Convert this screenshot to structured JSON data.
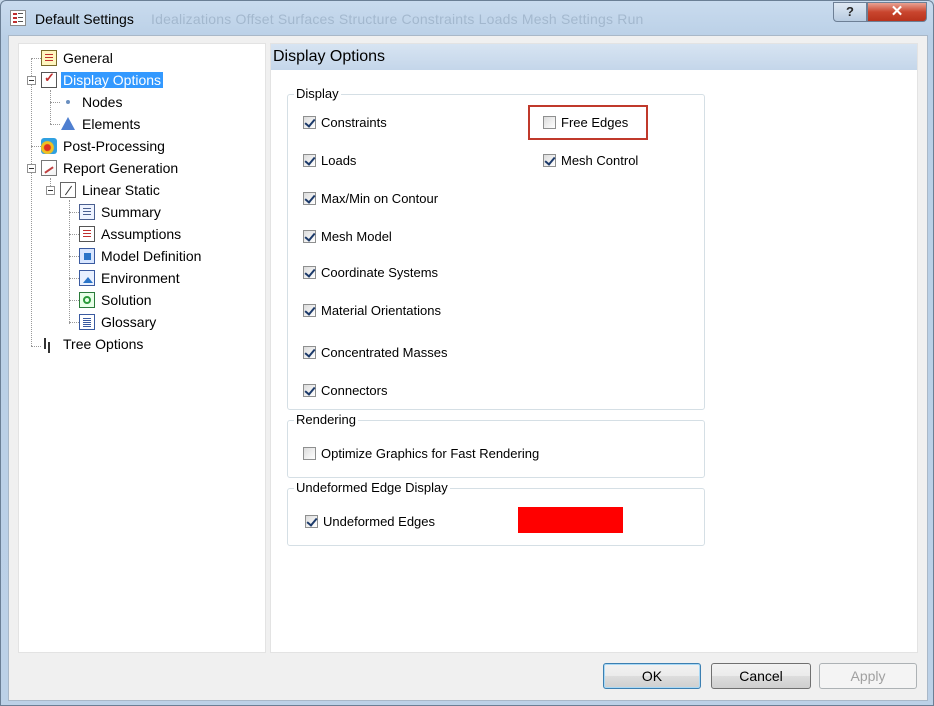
{
  "window": {
    "title": "Default Settings",
    "background_title_ghost": "Idealizations   Offset Surfaces   Structure   Constraints   Loads              Mesh Settings        Run",
    "help_label": "?",
    "close_label": "✕"
  },
  "tree": {
    "items": [
      {
        "label": "General"
      },
      {
        "label": "Display Options"
      },
      {
        "label": "Nodes"
      },
      {
        "label": "Elements"
      },
      {
        "label": "Post-Processing"
      },
      {
        "label": "Report Generation"
      },
      {
        "label": "Linear Static"
      },
      {
        "label": "Summary"
      },
      {
        "label": "Assumptions"
      },
      {
        "label": "Model Definition"
      },
      {
        "label": "Environment"
      },
      {
        "label": "Solution"
      },
      {
        "label": "Glossary"
      },
      {
        "label": "Tree Options"
      }
    ],
    "selected": "Display Options"
  },
  "panel": {
    "title": "Display Options",
    "display_group": {
      "title": "Display",
      "options": [
        {
          "label": "Constraints",
          "checked": true
        },
        {
          "label": "Loads",
          "checked": true
        },
        {
          "label": "Max/Min on Contour",
          "checked": true
        },
        {
          "label": "Mesh Model",
          "checked": true
        },
        {
          "label": "Coordinate Systems",
          "checked": true
        },
        {
          "label": "Material Orientations",
          "checked": true
        },
        {
          "label": "Concentrated Masses",
          "checked": true
        },
        {
          "label": "Connectors",
          "checked": true
        },
        {
          "label": "Free Edges",
          "checked": false
        },
        {
          "label": "Mesh Control",
          "checked": true
        }
      ]
    },
    "rendering_group": {
      "title": "Rendering",
      "options": [
        {
          "label": "Optimize Graphics for Fast Rendering",
          "checked": false
        }
      ]
    },
    "undeformed_group": {
      "title": "Undeformed Edge Display",
      "option": {
        "label": "Undeformed Edges",
        "checked": true
      },
      "color": "#ff0000"
    }
  },
  "buttons": {
    "ok": "OK",
    "cancel": "Cancel",
    "apply": "Apply"
  },
  "colors": {
    "selection": "#3399ff",
    "highlight_border": "#c0392b",
    "edge_color": "#ff0000"
  }
}
